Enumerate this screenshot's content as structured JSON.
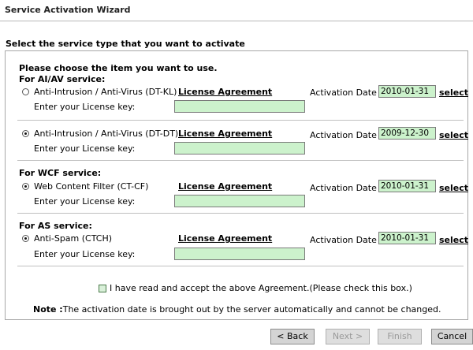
{
  "window": {
    "title": "Service Activation Wizard"
  },
  "section_title": "Select the service type that you want to activate",
  "intro": "Please choose the item you want to use.",
  "groups": {
    "aiav": "For AI/AV service:",
    "wcf": "For WCF service:",
    "as": "For AS service:"
  },
  "services": [
    {
      "name": "Anti-Intrusion / Anti-Virus (DT-KL)",
      "selected": false,
      "date": "2010-01-31"
    },
    {
      "name": "Anti-Intrusion / Anti-Virus (DT-DT)",
      "selected": true,
      "date": "2009-12-30"
    },
    {
      "name": "Web Content Filter (CT-CF)",
      "selected": true,
      "date": "2010-01-31"
    },
    {
      "name": "Anti-Spam (CTCH)",
      "selected": true,
      "date": "2010-01-31"
    }
  ],
  "labels": {
    "license_agreement": "License Agreement",
    "activation_date": "Activation Date :",
    "select": "select",
    "license_key": "Enter your License key:"
  },
  "agreement_text": "I have read and accept the above Agreement.(Please check this box.)",
  "agreement_checked": false,
  "note_label": "Note :",
  "note_text": "The activation date is brought out by the server automatically and cannot be changed.",
  "buttons": {
    "back": "< Back",
    "next": "Next >",
    "finish": "Finish",
    "cancel": "Cancel"
  },
  "colors": {
    "input_bg": "#ccf2cc",
    "border": "#a8a8a8"
  }
}
